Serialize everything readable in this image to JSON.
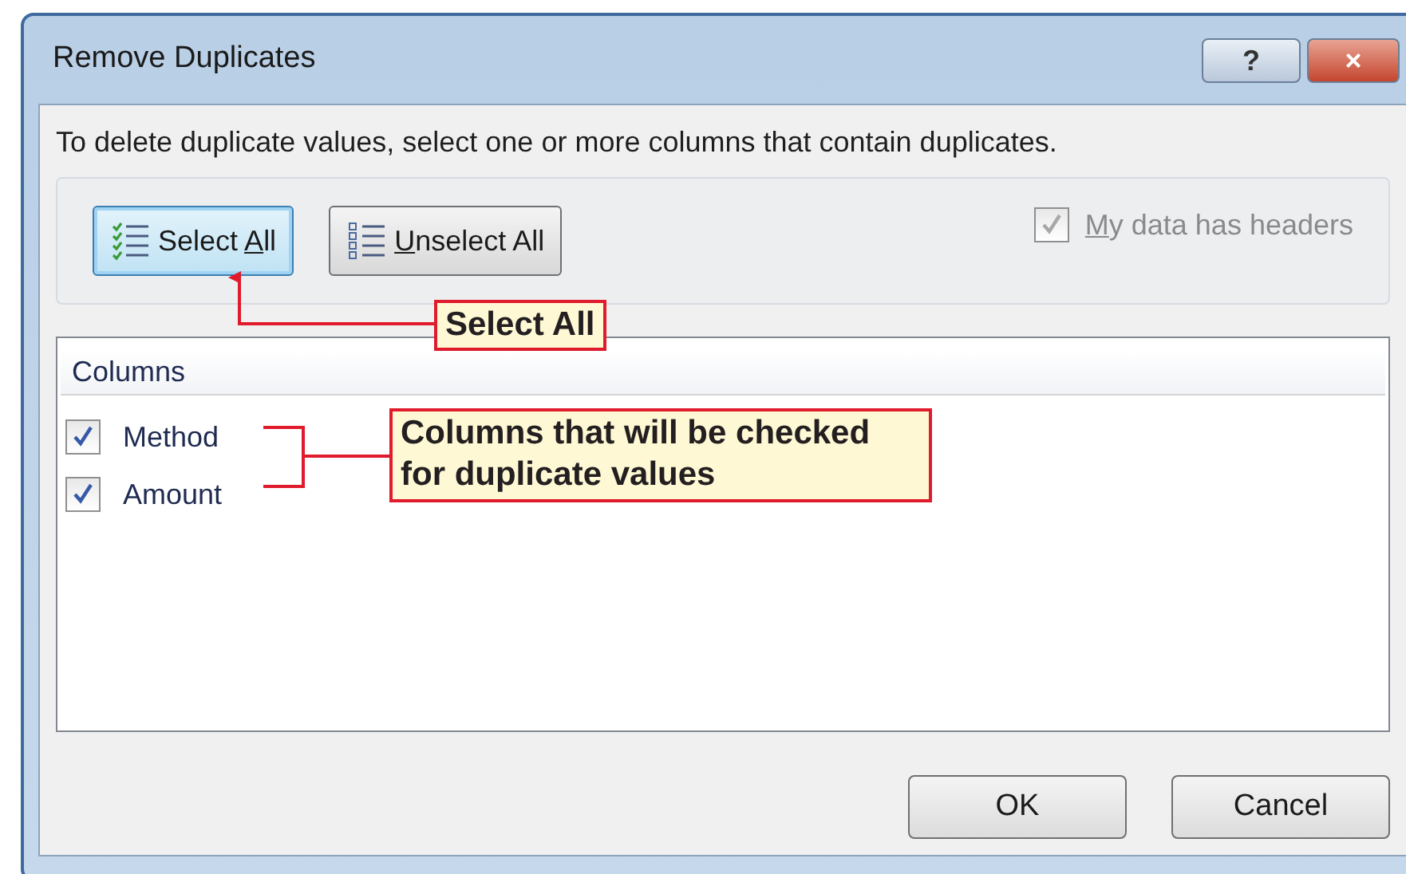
{
  "window": {
    "title": "Remove Duplicates",
    "help_button": "?",
    "close_button": "×"
  },
  "instruction": "To delete duplicate values, select one or more columns that contain duplicates.",
  "buttons_top": [
    {
      "label_parts": [
        {
          "text": "Select ",
          "underlined": false
        },
        {
          "text": "A",
          "underlined": true
        },
        {
          "text": "ll",
          "underlined": false
        }
      ],
      "focused": true
    },
    {
      "label_parts": [
        {
          "text": "U",
          "underlined": true
        },
        {
          "text": "nselect All",
          "underlined": false
        }
      ],
      "focused": false
    }
  ],
  "headers_checkbox": {
    "label_parts": [
      {
        "text": "M",
        "underlined": true
      },
      {
        "text": "y data has headers",
        "underlined": false
      }
    ],
    "checked": true,
    "disabled": true
  },
  "columns_list": {
    "header": "Columns",
    "items": [
      {
        "label": "Method",
        "checked": true
      },
      {
        "label": "Amount",
        "checked": true
      }
    ]
  },
  "buttons_bottom": [
    "OK",
    "Cancel"
  ],
  "callouts": [
    {
      "text": "Select All"
    },
    {
      "text": "Columns that will be checked for duplicate values"
    }
  ]
}
